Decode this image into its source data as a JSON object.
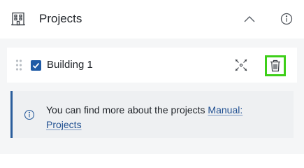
{
  "header": {
    "title": "Projects",
    "building_icon": "building-icon",
    "collapse_icon": "chevron-up-icon",
    "info_icon": "info-icon"
  },
  "projects": [
    {
      "label": "Building 1",
      "checked": true,
      "drag_icon": "drag-handle-icon",
      "zoom_icon": "zoom-to-extent-icon",
      "delete_icon": "trash-icon"
    }
  ],
  "note": {
    "icon": "info-icon",
    "text": "You can find more about the projects ",
    "link_text": "Manual: Projects"
  },
  "colors": {
    "accent": "#1f5ba6",
    "note_border": "#2a5d9c",
    "highlight": "#3ecf19",
    "link": "#1f4f91"
  }
}
